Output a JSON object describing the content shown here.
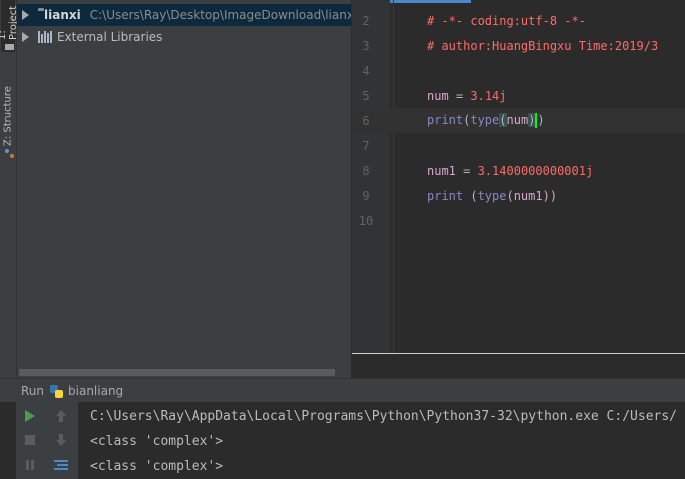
{
  "left_strip": {
    "project_tab": "1: Project",
    "structure_tab": "Z: Structure"
  },
  "project": {
    "root_name": "lianxi",
    "root_path": "C:\\Users\\Ray\\Desktop\\ImageDownload\\lianxi",
    "external_libraries": "External Libraries"
  },
  "editor": {
    "lines": [
      {
        "n": "2"
      },
      {
        "n": "3"
      },
      {
        "n": "4"
      },
      {
        "n": "5"
      },
      {
        "n": "6"
      },
      {
        "n": "7"
      },
      {
        "n": "8"
      },
      {
        "n": "9"
      },
      {
        "n": "10"
      }
    ],
    "l2": "# -*- coding:utf-8 -*-",
    "l3": "# author:HuangBingxu Time:2019/3",
    "l5_var": "num",
    "l5_op": " = ",
    "l5_val": "3.14j",
    "l6_print": "print",
    "l6_open": "(",
    "l6_type": "type",
    "l6_open2": "(",
    "l6_arg": "num",
    "l6_close": ")",
    "l6_close2": ")",
    "l8_var": "num1",
    "l8_op": " = ",
    "l8_val": "3.1400000000001j",
    "l9_print": "print",
    "l9_rest_open": " (",
    "l9_type": "type",
    "l9_rest": "(num1))"
  },
  "run": {
    "label": "Run",
    "config_name": "bianliang",
    "console": [
      "C:\\Users\\Ray\\AppData\\Local\\Programs\\Python\\Python37-32\\python.exe C:/Users/",
      "<class 'complex'>",
      "<class 'complex'>"
    ]
  },
  "colors": {
    "selection": "#0d293e",
    "run_green": "#499c54",
    "caret": "#00ff00"
  },
  "icons": [
    "folder-icon",
    "library-icon",
    "python-icon",
    "run-icon",
    "stop-icon",
    "pause-icon",
    "up-icon",
    "down-icon",
    "soft-wrap-icon",
    "structure-icon"
  ]
}
